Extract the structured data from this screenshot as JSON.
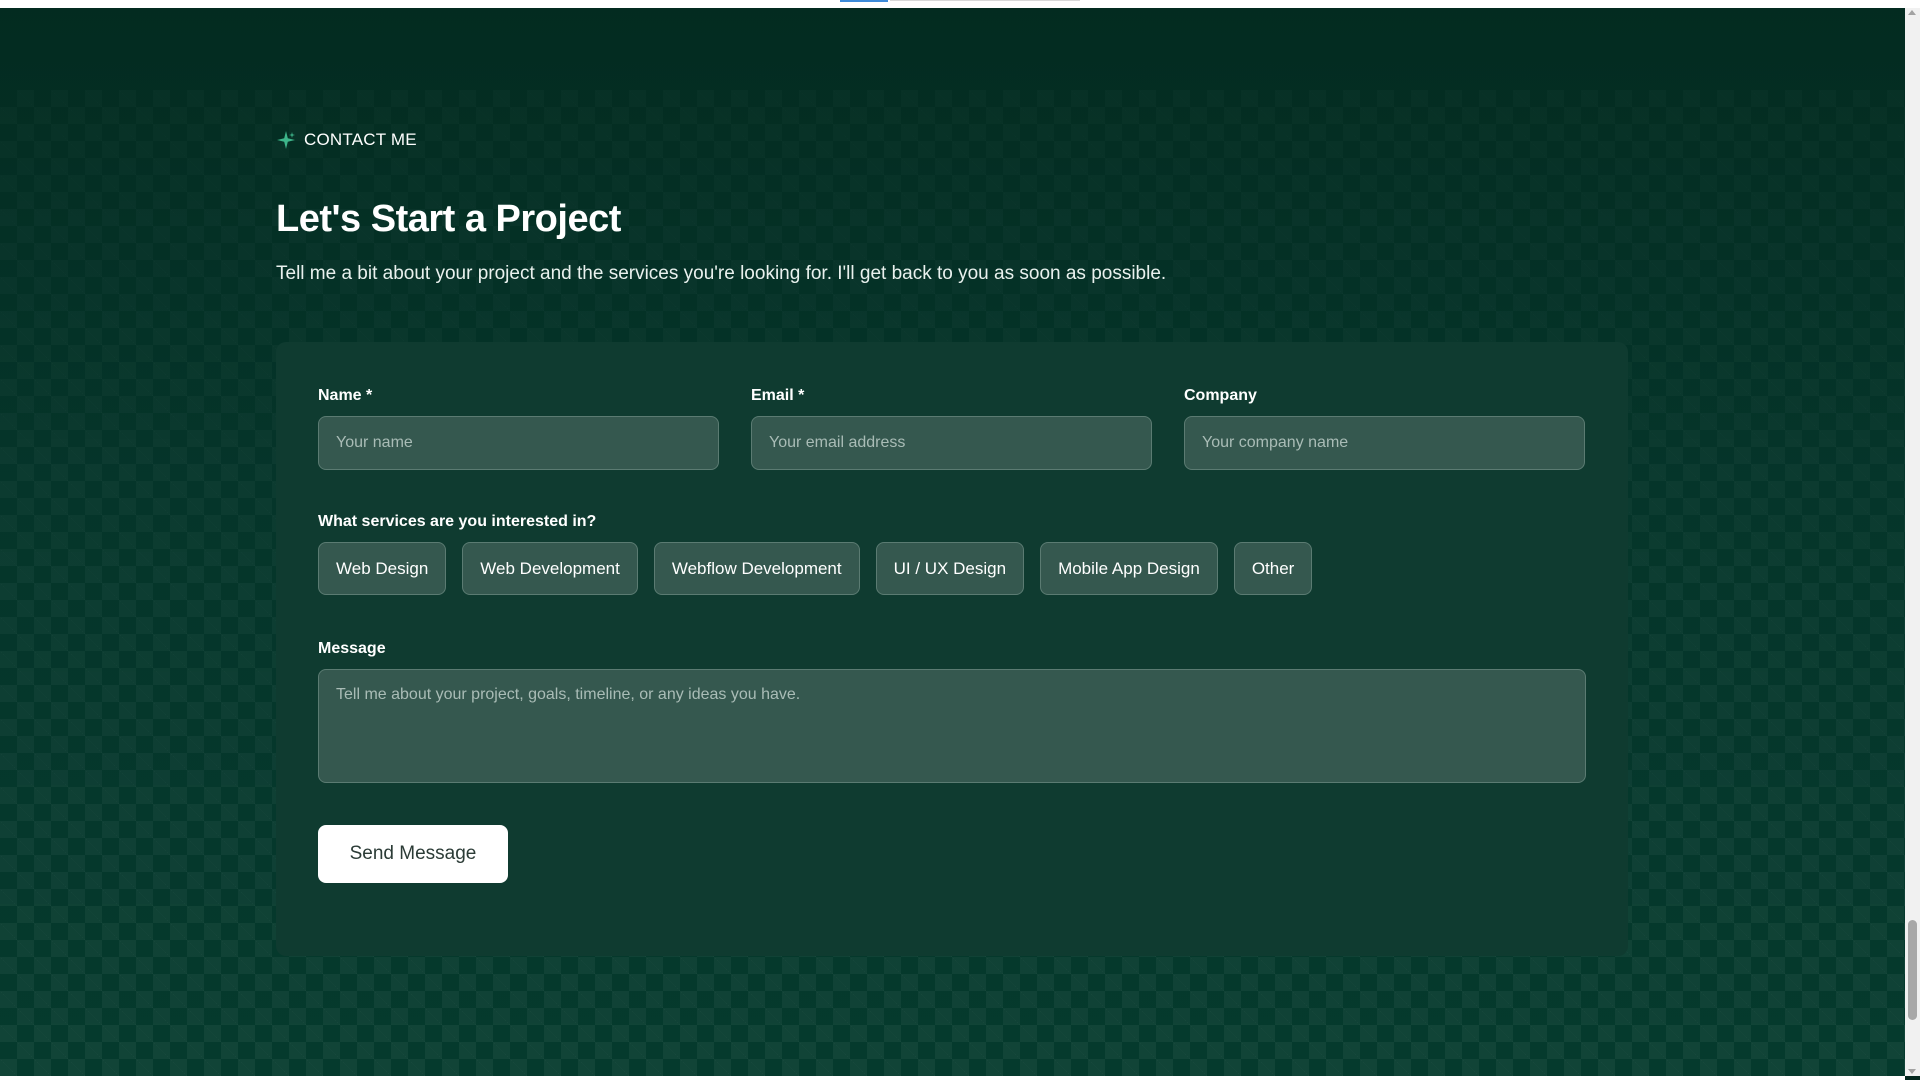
{
  "section": {
    "eyebrow": "CONTACT ME",
    "title": "Let's Start a Project",
    "subtitle": "Tell me a bit about your project and the services you're looking for. I'll get back to you as soon as possible."
  },
  "form": {
    "name": {
      "label": "Name *",
      "placeholder": "Your name"
    },
    "email": {
      "label": "Email *",
      "placeholder": "Your email address"
    },
    "company": {
      "label": "Company",
      "placeholder": "Your company name"
    },
    "services": {
      "label": "What services are you interested in?",
      "options": [
        "Web Design",
        "Web Development",
        "Webflow Development",
        "UI / UX Design",
        "Mobile App Design",
        "Other"
      ]
    },
    "message": {
      "label": "Message",
      "placeholder": "Tell me about your project, goals, timeline, or any ideas you have."
    },
    "submit_label": "Send Message"
  },
  "colors": {
    "background": "#03271e",
    "card": "#0f3b30",
    "input": "#35584f",
    "accent": "#3db58a"
  },
  "icons": {
    "eyebrow": "sparkle-icon"
  }
}
